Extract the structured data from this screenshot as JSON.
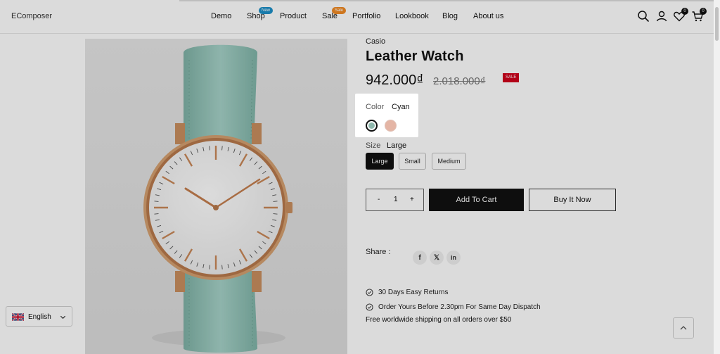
{
  "header": {
    "brand": "EComposer",
    "nav": [
      {
        "label": "Demo"
      },
      {
        "label": "Shop",
        "badge": "New"
      },
      {
        "label": "Product"
      },
      {
        "label": "Sale",
        "badge": "Sale"
      },
      {
        "label": "Portfolio"
      },
      {
        "label": "Lookbook"
      },
      {
        "label": "Blog"
      },
      {
        "label": "About us"
      }
    ],
    "wishlist_count": "0",
    "cart_count": "0",
    "icons": [
      "search-icon",
      "account-icon",
      "wishlist-icon",
      "cart-icon"
    ]
  },
  "product": {
    "vendor": "Casio",
    "title": "Leather Watch",
    "price": "942.000₫",
    "compare_price": "2.018.000₫",
    "sale_badge": "SALE",
    "color": {
      "label": "Color",
      "value": "Cyan",
      "swatches": [
        {
          "name": "Cyan",
          "hex": "#8fb8ad",
          "selected": true
        },
        {
          "name": "Pink",
          "hex": "#e4b5a5",
          "selected": false
        }
      ]
    },
    "size": {
      "label": "Size",
      "value": "Large",
      "options": [
        {
          "label": "Large",
          "selected": true
        },
        {
          "label": "Small",
          "selected": false
        },
        {
          "label": "Medium",
          "selected": false
        }
      ]
    },
    "quantity": {
      "minus": "-",
      "value": "1",
      "plus": "+"
    },
    "add_to_cart": "Add To Cart",
    "buy_now": "Buy It Now",
    "share_label": "Share :",
    "share_icons": [
      "facebook-icon",
      "x-twitter-icon",
      "linkedin-icon"
    ],
    "features": [
      "30 Days Easy Returns",
      "Order Yours Before 2.30pm For Same Day Dispatch"
    ],
    "shipping_note": "Free worldwide shipping on all orders over $50"
  },
  "language": {
    "label": "English"
  },
  "colors": {
    "accent": "#111111",
    "sale_red": "#d0021b",
    "badge_new": "#1e90c8",
    "badge_sale": "#f08a24"
  }
}
